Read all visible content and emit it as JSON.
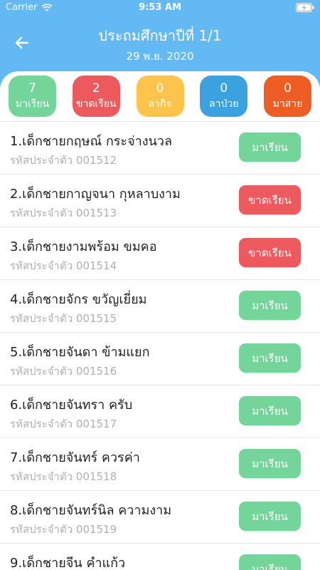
{
  "status_bar": {
    "carrier": "Carrier",
    "time": "9:53 AM"
  },
  "header": {
    "title": "ประถมศึกษาปีที่ 1/1",
    "date": "29 พ.ย. 2020"
  },
  "stats": [
    {
      "count": "7",
      "label": "มาเรียน",
      "color": "#73d59a"
    },
    {
      "count": "2",
      "label": "ขาดเรียน",
      "color": "#ec5a5e"
    },
    {
      "count": "0",
      "label": "ลากิจ",
      "color": "#fdc44b"
    },
    {
      "count": "0",
      "label": "ลาป่วย",
      "color": "#3ba2e0"
    },
    {
      "count": "0",
      "label": "มาสาย",
      "color": "#ee5d23"
    }
  ],
  "status_colors": {
    "present": "#73d59a",
    "absent": "#ec5a5e"
  },
  "students": [
    {
      "name": "1.เด็กชายกฤษณ์ กระจ่างนวล",
      "id": "รหัสประจำตัว 001512",
      "status_label": "มาเรียน",
      "status": "present"
    },
    {
      "name": "2.เด็กชายกาญจนา กุหลาบงาม",
      "id": "รหัสประจำตัว 001513",
      "status_label": "ขาดเรียน",
      "status": "absent"
    },
    {
      "name": "3.เด็กชายงามพร้อม ขมคอ",
      "id": "รหัสประจำตัว 001514",
      "status_label": "ขาดเรียน",
      "status": "absent"
    },
    {
      "name": "4.เด็กชายจักร ขวัญเยี่ยม",
      "id": "รหัสประจำตัว 001515",
      "status_label": "มาเรียน",
      "status": "present"
    },
    {
      "name": "5.เด็กชายจันดา ข้ามแยก",
      "id": "รหัสประจำตัว 001516",
      "status_label": "มาเรียน",
      "status": "present"
    },
    {
      "name": "6.เด็กชายจันทรา ครับ",
      "id": "รหัสประจำตัว 001517",
      "status_label": "มาเรียน",
      "status": "present"
    },
    {
      "name": "7.เด็กชายจันทร์ ควรค่า",
      "id": "รหัสประจำตัว 001518",
      "status_label": "มาเรียน",
      "status": "present"
    },
    {
      "name": "8.เด็กชายจันทร์นิล ความงาม",
      "id": "รหัสประจำตัว 001519",
      "status_label": "มาเรียน",
      "status": "present"
    },
    {
      "name": "9.เด็กชายจีน คำแก้ว",
      "id": "",
      "status_label": "มาเรียน",
      "status": "present"
    }
  ]
}
